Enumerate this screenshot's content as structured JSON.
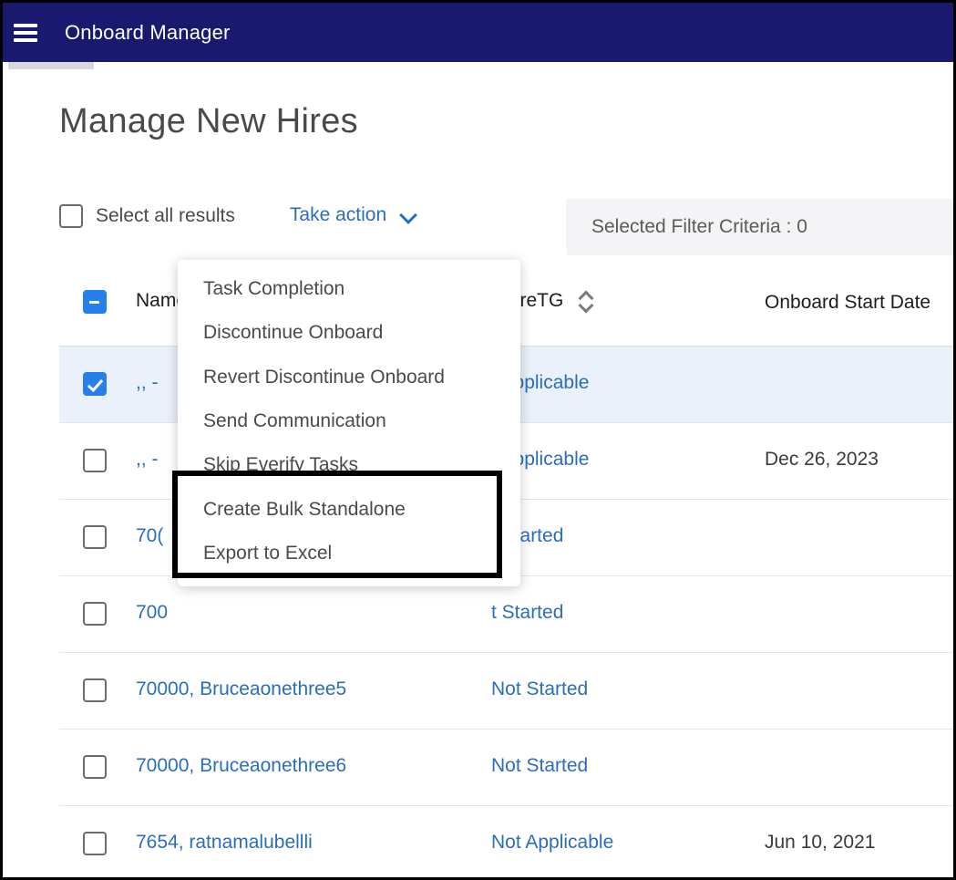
{
  "navbar": {
    "menu_icon": "hamburger-icon",
    "title": "Onboard Manager"
  },
  "page": {
    "title": "Manage New Hires"
  },
  "toolbar": {
    "select_all_label": "Select all results",
    "select_all_checked": false,
    "take_action_label": "Take action",
    "take_action_caret": "chevron-down-icon",
    "filter_criteria_label": "Selected Filter Criteria : 0"
  },
  "menu": {
    "items": [
      {
        "label": "Task Completion",
        "highlighted": false
      },
      {
        "label": "Discontinue Onboard",
        "highlighted": false
      },
      {
        "label": "Revert Discontinue Onboard",
        "highlighted": false
      },
      {
        "label": "Send Communication",
        "highlighted": false
      },
      {
        "label": "Skip Everify Tasks",
        "highlighted": true
      },
      {
        "label": "Create Bulk Standalone",
        "highlighted": true
      },
      {
        "label": "Export to Excel",
        "highlighted": false
      }
    ]
  },
  "table": {
    "header": {
      "select_state": "indeterminate",
      "name": "Name",
      "status": "whireTG",
      "status_sortable": true,
      "date": "Onboard Start Date"
    },
    "rows": [
      {
        "checked": true,
        "selected": true,
        "name": ",, -",
        "status": "t Applicable",
        "date": ""
      },
      {
        "checked": false,
        "selected": false,
        "name": ",, -",
        "status": "t Applicable",
        "date": "Dec 26, 2023"
      },
      {
        "checked": false,
        "selected": false,
        "name": "70(",
        "status": "t Started",
        "date": ""
      },
      {
        "checked": false,
        "selected": false,
        "name": "700",
        "status": "t Started",
        "date": ""
      },
      {
        "checked": false,
        "selected": false,
        "name": "70000, Bruceaonethree5",
        "status": "Not Started",
        "date": ""
      },
      {
        "checked": false,
        "selected": false,
        "name": "70000, Bruceaonethree6",
        "status": "Not Started",
        "date": ""
      },
      {
        "checked": false,
        "selected": false,
        "name": "7654, ratnamalubellli",
        "status": "Not Applicable",
        "date": "Jun 10, 2021"
      }
    ]
  },
  "colors": {
    "navbar_bg": "#191970",
    "link_blue": "#2a6ebb",
    "checkbox_blue": "#2680eb",
    "selected_row_bg": "#eaf1fa",
    "filter_bg": "#f4f4f6",
    "annotation_border": "#000000"
  }
}
